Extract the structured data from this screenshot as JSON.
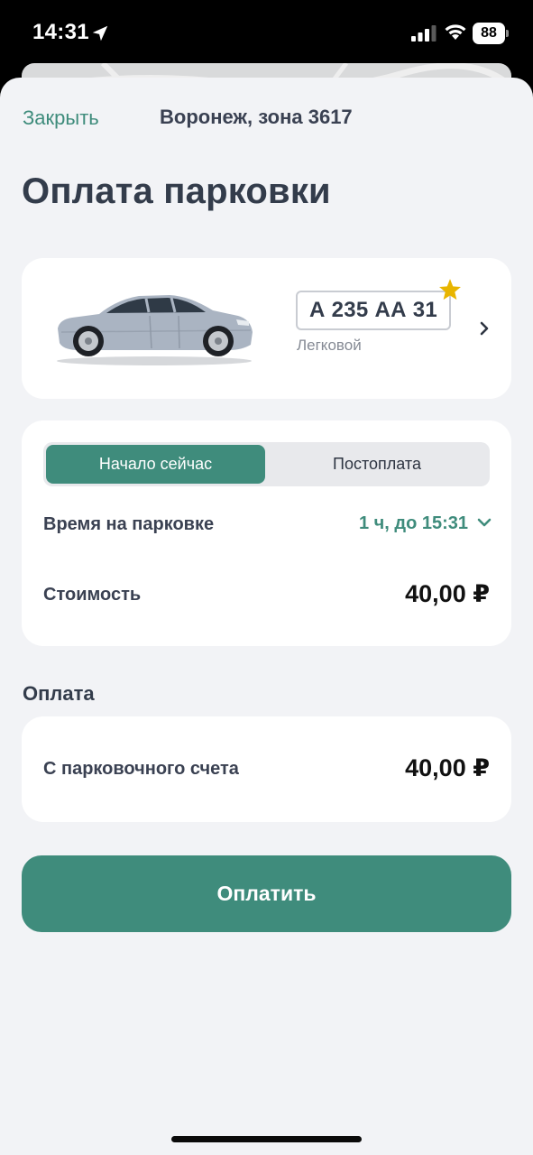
{
  "status_bar": {
    "time": "14:31",
    "battery": "88",
    "icons": [
      "location-arrow-icon",
      "cellular-signal-icon",
      "wifi-icon",
      "battery-icon"
    ]
  },
  "header": {
    "close_label": "Закрыть",
    "zone": "Воронеж, зона 3617"
  },
  "page_title": "Оплата парковки",
  "vehicle": {
    "plate": "А 235 АА 31",
    "type": "Легковой",
    "favorite": true
  },
  "payment_mode": {
    "options": [
      "Начало сейчас",
      "Постоплата"
    ],
    "selected": "Начало сейчас"
  },
  "parking_time": {
    "label": "Время на парковке",
    "value": "1 ч, до 15:31"
  },
  "cost": {
    "label": "Стоимость",
    "amount": "40,00 ₽"
  },
  "payment": {
    "section_label": "Оплата",
    "source_label": "С парковочного счета",
    "amount": "40,00 ₽"
  },
  "pay_button_label": "Оплатить",
  "colors": {
    "accent": "#3f8c7c",
    "title": "#333c4b",
    "background": "#f2f3f6",
    "star": "#e8b500"
  }
}
